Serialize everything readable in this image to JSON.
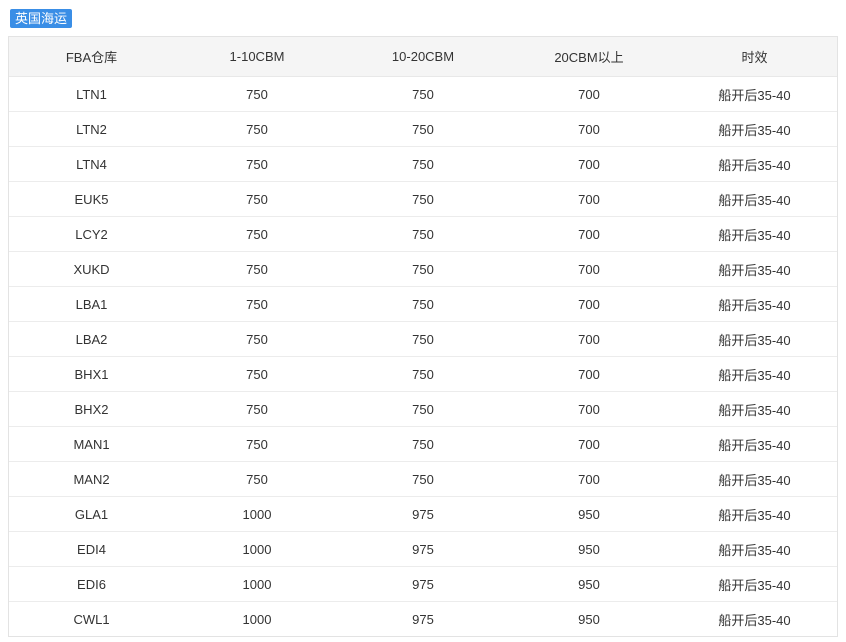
{
  "badge": {
    "label": "英国海运"
  },
  "table": {
    "headers": [
      "FBA仓库",
      "1-10CBM",
      "10-20CBM",
      "20CBM以上",
      "时效"
    ],
    "rows": [
      [
        "LTN1",
        "750",
        "750",
        "700",
        "船开后35-40"
      ],
      [
        "LTN2",
        "750",
        "750",
        "700",
        "船开后35-40"
      ],
      [
        "LTN4",
        "750",
        "750",
        "700",
        "船开后35-40"
      ],
      [
        "EUK5",
        "750",
        "750",
        "700",
        "船开后35-40"
      ],
      [
        "LCY2",
        "750",
        "750",
        "700",
        "船开后35-40"
      ],
      [
        "XUKD",
        "750",
        "750",
        "700",
        "船开后35-40"
      ],
      [
        "LBA1",
        "750",
        "750",
        "700",
        "船开后35-40"
      ],
      [
        "LBA2",
        "750",
        "750",
        "700",
        "船开后35-40"
      ],
      [
        "BHX1",
        "750",
        "750",
        "700",
        "船开后35-40"
      ],
      [
        "BHX2",
        "750",
        "750",
        "700",
        "船开后35-40"
      ],
      [
        "MAN1",
        "750",
        "750",
        "700",
        "船开后35-40"
      ],
      [
        "MAN2",
        "750",
        "750",
        "700",
        "船开后35-40"
      ],
      [
        "GLA1",
        "1000",
        "975",
        "950",
        "船开后35-40"
      ],
      [
        "EDI4",
        "1000",
        "975",
        "950",
        "船开后35-40"
      ],
      [
        "EDI6",
        "1000",
        "975",
        "950",
        "船开后35-40"
      ],
      [
        "CWL1",
        "1000",
        "975",
        "950",
        "船开后35-40"
      ]
    ]
  },
  "colors": {
    "badge_bg": "#3a8ee6",
    "header_bg": "#f5f5f5",
    "border": "#e3e3e3"
  }
}
